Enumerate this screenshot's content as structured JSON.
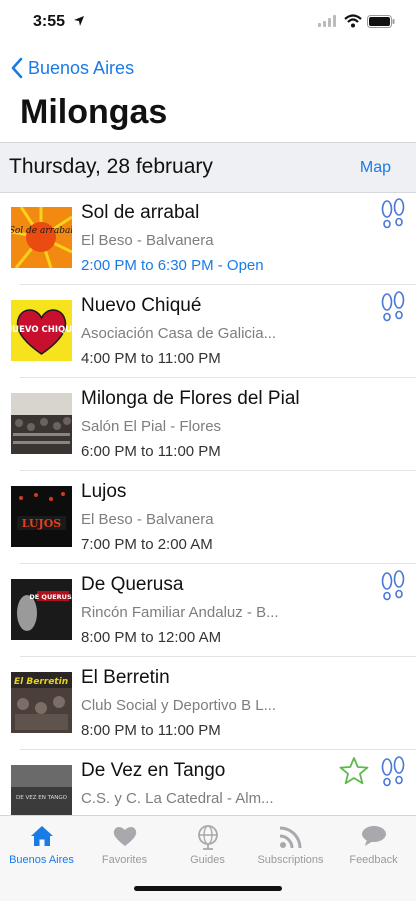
{
  "status": {
    "time": "3:55"
  },
  "nav": {
    "back_label": "Buenos Aires",
    "title": "Milongas"
  },
  "section": {
    "date": "Thursday, 28 february",
    "map_label": "Map"
  },
  "milongas": [
    {
      "name": "Sol de arrabal",
      "venue": "El Beso - Balvanera",
      "time": "2:00 PM to 6:30 PM - Open",
      "feet": true,
      "star": false,
      "thumb_text": "Sol de arrabal"
    },
    {
      "name": "Nuevo Chiqué",
      "venue": "Asociación Casa de Galicia...",
      "time": "4:00 PM to 11:00 PM",
      "feet": true,
      "star": false,
      "thumb_text": "NUEVO CHIQUE"
    },
    {
      "name": "Milonga de Flores del Pial",
      "venue": "Salón El Pial - Flores",
      "time": "6:00 PM to 11:00 PM",
      "feet": false,
      "star": false,
      "thumb_text": ""
    },
    {
      "name": "Lujos",
      "venue": "El Beso - Balvanera",
      "time": "7:00 PM to 2:00 AM",
      "feet": false,
      "star": false,
      "thumb_text": "LUJOS"
    },
    {
      "name": "De Querusa",
      "venue": "Rincón Familiar Andaluz - B...",
      "time": "8:00 PM to 12:00 AM",
      "feet": true,
      "star": false,
      "thumb_text": "DE QUERUSA"
    },
    {
      "name": "El Berretin",
      "venue": "Club Social y Deportivo B L...",
      "time": "8:00 PM to 11:00 PM",
      "feet": false,
      "star": false,
      "thumb_text": "El Berretin"
    },
    {
      "name": "De Vez en Tango",
      "venue": "C.S. y C. La Catedral - Alm...",
      "time": "",
      "feet": true,
      "star": true,
      "thumb_text": "DE VEZ EN TANGO"
    }
  ],
  "tabs": [
    {
      "label": "Buenos Aires",
      "icon": "home-icon",
      "active": true
    },
    {
      "label": "Favorites",
      "icon": "heart-icon",
      "active": false
    },
    {
      "label": "Guides",
      "icon": "globe-icon",
      "active": false
    },
    {
      "label": "Subscriptions",
      "icon": "rss-icon",
      "active": false
    },
    {
      "label": "Feedback",
      "icon": "chat-icon",
      "active": false
    }
  ],
  "colors": {
    "accent": "#1a7be6",
    "feet": "#4a78d8",
    "star": "#5fb84a",
    "section_bg": "#eff0f4"
  }
}
